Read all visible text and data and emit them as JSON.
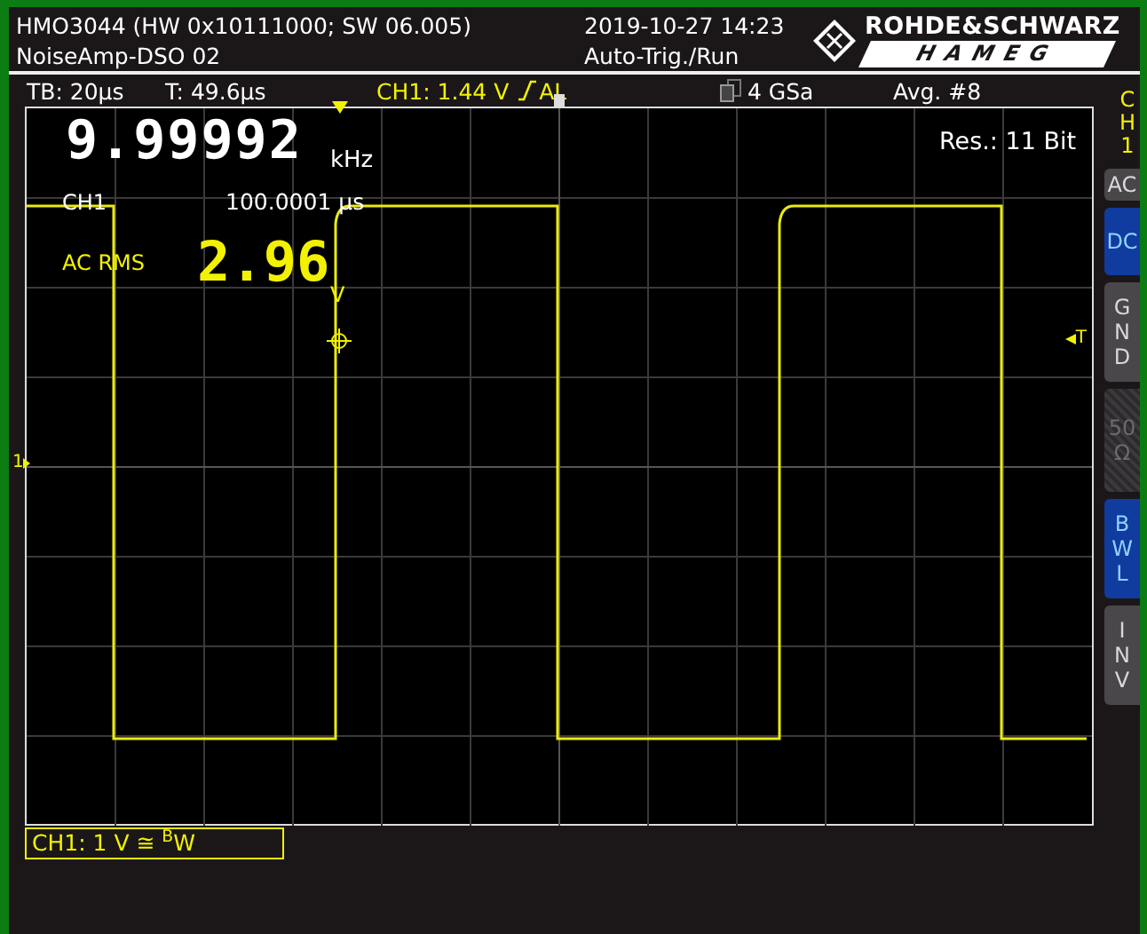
{
  "header": {
    "model": "HMO3044 (HW 0x10111000; SW 06.005)",
    "device_name": "NoiseAmp-DSO 02",
    "datetime": "2019-10-27 14:23",
    "trigger_mode": "Auto-Trig./Run",
    "logo_top": "ROHDE&SCHWARZ",
    "logo_bottom": "HAMEG"
  },
  "status_bar": {
    "timebase": "TB: 20µs",
    "trigger_time": "T: 49.6µs",
    "trigger_source": "CH1: 1.44 V",
    "trigger_coupling": "AL",
    "sample_rate": "4 GSa",
    "averaging": "Avg. #8"
  },
  "measurements": {
    "frequency": "9.99992",
    "frequency_unit": "kHz",
    "source": "CH1",
    "period": "100.0001 µs",
    "rms_label": "AC RMS",
    "rms_value": "2.96",
    "rms_unit": "V",
    "resolution": "Res.: 11 Bit"
  },
  "markers": {
    "trigger_level": "T",
    "channel_ground": "1"
  },
  "side_panel": {
    "channel": [
      "C",
      "H",
      "1"
    ],
    "buttons": [
      {
        "lines": [
          "AC"
        ],
        "selected": false,
        "disabled": false
      },
      {
        "lines": [
          "DC"
        ],
        "selected": true,
        "disabled": false
      },
      {
        "lines": [
          "G",
          "N",
          "D"
        ],
        "selected": false,
        "disabled": false
      },
      {
        "lines": [
          "50",
          "Ω"
        ],
        "selected": false,
        "disabled": true
      },
      {
        "lines": [
          "B",
          "W",
          "L"
        ],
        "selected": true,
        "disabled": false
      },
      {
        "lines": [
          "I",
          "N",
          "V"
        ],
        "selected": false,
        "disabled": false
      }
    ]
  },
  "channel_label": "CH1: 1 V ≅ $^{B}$W"
}
